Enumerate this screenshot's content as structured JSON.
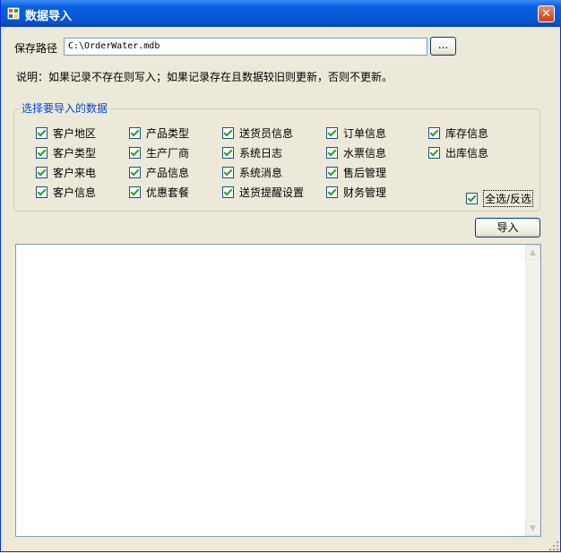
{
  "window": {
    "title": "数据导入",
    "close_label": "✕"
  },
  "path": {
    "label": "保存路径",
    "value": "C:\\OrderWater.mdb",
    "browse_label": "..."
  },
  "note": "说明：如果记录不存在则写入；如果记录存在且数据较旧则更新，否则不更新。",
  "group": {
    "title": "选择要导入的数据",
    "items": [
      "客户地区",
      "客户类型",
      "客户来电",
      "客户信息",
      "产品类型",
      "生产厂商",
      "产品信息",
      "优惠套餐",
      "送货员信息",
      "系统日志",
      "系统消息",
      "送货提醒设置",
      "订单信息",
      "水票信息",
      "售后管理",
      "财务管理",
      "库存信息",
      "出库信息"
    ],
    "toggle_all_label": "全选/反选"
  },
  "import_button_label": "导入",
  "colors": {
    "title_bar": "#0757d4",
    "group_title": "#0046d5",
    "window_bg": "#ece9d8",
    "check": "#21a121"
  }
}
